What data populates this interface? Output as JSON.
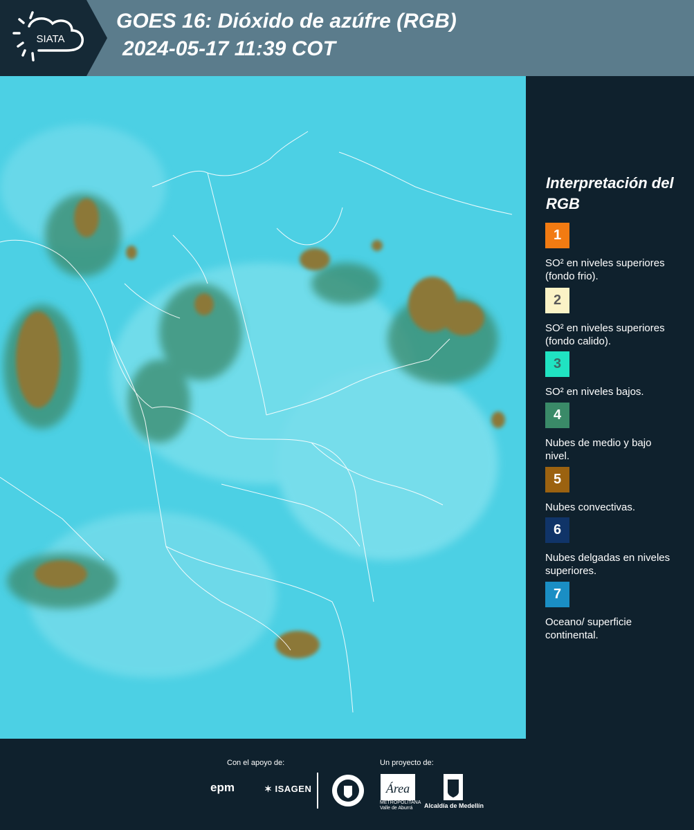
{
  "header": {
    "brand": "SIATA",
    "title_line1": "GOES 16: Dióxido de azúfre (RGB)",
    "title_line2": "2024-05-17 11:39 COT"
  },
  "legend": {
    "title": "Interpretación del RGB",
    "items": [
      {
        "number": "1",
        "color": "#f27b12",
        "text_color": "#ffffff",
        "label": "SO² en niveles superiores (fondo frio)."
      },
      {
        "number": "2",
        "color": "#fbf3c6",
        "text_color": "#5a5a5a",
        "label": "SO² en niveles superiores (fondo calido)."
      },
      {
        "number": "3",
        "color": "#20e3c2",
        "text_color": "#3a6a66",
        "label": "SO² en niveles bajos."
      },
      {
        "number": "4",
        "color": "#3a8a68",
        "text_color": "#ffffff",
        "label": "Nubes de medio y bajo nivel."
      },
      {
        "number": "5",
        "color": "#9b6210",
        "text_color": "#ffffff",
        "label": "Nubes convectivas."
      },
      {
        "number": "6",
        "color": "#103468",
        "text_color": "#ffffff",
        "label": "Nubes delgadas en niveles superiores."
      },
      {
        "number": "7",
        "color": "#1a8ec4",
        "text_color": "#ffffff",
        "label": "Oceano/ superficie continental."
      }
    ]
  },
  "footer": {
    "support_label": "Con el apoyo de:",
    "project_label": "Un proyecto de:",
    "epm": "epm",
    "isagen": "ISAGEN",
    "area_name": "Área",
    "area_sub": "METROPOLITANA",
    "area_sub2": "Valle de Aburrá",
    "alcaldia": "Alcaldía de Medellín"
  },
  "colors": {
    "header_bg": "#5b7c8c",
    "panel_bg": "#0f212d",
    "map_base": "#4fd2e6",
    "cloud_convective": "#8a7a3a",
    "cloud_low": "#4a8a6a"
  }
}
